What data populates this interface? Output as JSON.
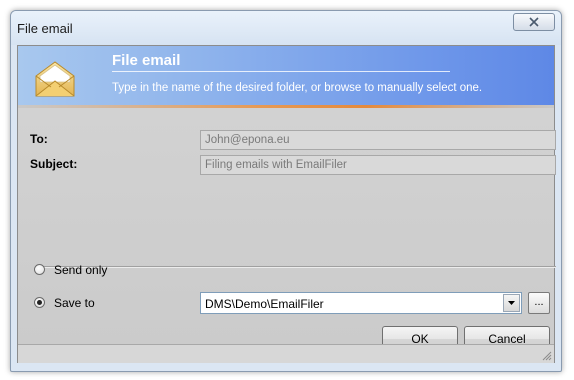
{
  "window": {
    "title": "File email",
    "close_icon": "close-icon"
  },
  "banner": {
    "title": "File email",
    "subtitle": "Type in the name of the desired folder, or browse to manually select one.",
    "icon": "envelope-icon"
  },
  "form": {
    "to_label": "To:",
    "to_value": "John@epona.eu",
    "subject_label": "Subject:",
    "subject_value": "Filing emails with EmailFiler"
  },
  "options": {
    "send_only_label": "Send only",
    "save_to_label": "Save to",
    "selected": "Save to"
  },
  "save_to": {
    "folder_value": "DMS\\Demo\\EmailFiler",
    "browse_label": "..."
  },
  "buttons": {
    "ok_label": "OK",
    "cancel_label": "Cancel"
  },
  "colors": {
    "banner_start": "#a8c8ee",
    "banner_end": "#5e88e6",
    "accent_line": "#e58a3c"
  }
}
